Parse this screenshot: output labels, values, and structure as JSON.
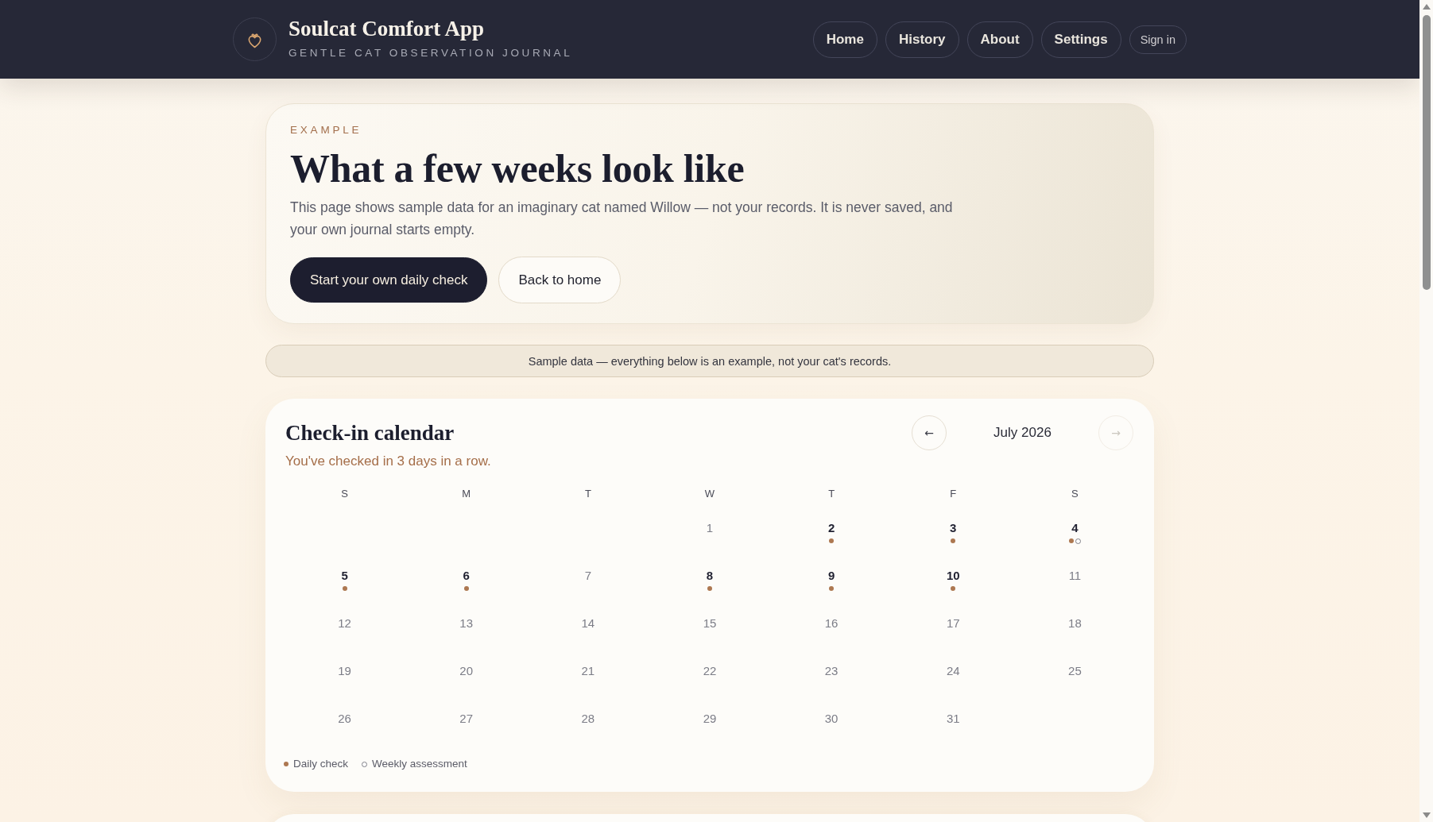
{
  "header": {
    "app_title": "Soulcat Comfort App",
    "tagline": "GENTLE CAT OBSERVATION JOURNAL",
    "nav": [
      "Home",
      "History",
      "About",
      "Settings"
    ],
    "sign_in": "Sign in"
  },
  "hero": {
    "eyebrow": "EXAMPLE",
    "title": "What a few weeks look like",
    "description": "This page shows sample data for an imaginary cat named Willow — not your records. It is never saved, and your own journal starts empty.",
    "buttons": [
      {
        "label": "Start your own daily check",
        "kind": "primary"
      },
      {
        "label": "Back to home",
        "kind": "secondary"
      }
    ]
  },
  "notice": "Sample data — everything below is an example, not your cat's records.",
  "calendar": {
    "title": "Check-in calendar",
    "streak": "You've checked in 3 days in a row.",
    "prev": {
      "label": "←",
      "disabled": false
    },
    "month": "July 2026",
    "next": {
      "label": "→",
      "disabled": true
    },
    "weekdays": [
      "S",
      "M",
      "T",
      "W",
      "T",
      "F",
      "S"
    ],
    "weeks": [
      {
        "days": [
          {
            "kind": "blank"
          },
          {
            "kind": "blank"
          },
          {
            "kind": "blank"
          },
          {
            "kind": "day",
            "date": "1",
            "daily": false,
            "weekly": false
          },
          {
            "kind": "day",
            "date": "2",
            "daily": true,
            "weekly": false
          },
          {
            "kind": "day",
            "date": "3",
            "daily": true,
            "weekly": false
          },
          {
            "kind": "day",
            "date": "4",
            "daily": true,
            "weekly": true
          }
        ]
      },
      {
        "days": [
          {
            "kind": "day",
            "date": "5",
            "daily": true,
            "weekly": false
          },
          {
            "kind": "day",
            "date": "6",
            "daily": true,
            "weekly": false
          },
          {
            "kind": "day",
            "date": "7",
            "daily": false,
            "weekly": false
          },
          {
            "kind": "day",
            "date": "8",
            "daily": true,
            "weekly": false
          },
          {
            "kind": "day",
            "date": "9",
            "daily": true,
            "weekly": false
          },
          {
            "kind": "day",
            "date": "10",
            "daily": true,
            "weekly": false
          },
          {
            "kind": "day",
            "date": "11",
            "daily": false,
            "weekly": false
          }
        ]
      },
      {
        "days": [
          {
            "kind": "day",
            "date": "12",
            "daily": false,
            "weekly": false
          },
          {
            "kind": "day",
            "date": "13",
            "daily": false,
            "weekly": false
          },
          {
            "kind": "day",
            "date": "14",
            "daily": false,
            "weekly": false
          },
          {
            "kind": "day",
            "date": "15",
            "daily": false,
            "weekly": false
          },
          {
            "kind": "day",
            "date": "16",
            "daily": false,
            "weekly": false
          },
          {
            "kind": "day",
            "date": "17",
            "daily": false,
            "weekly": false
          },
          {
            "kind": "day",
            "date": "18",
            "daily": false,
            "weekly": false
          }
        ]
      },
      {
        "days": [
          {
            "kind": "day",
            "date": "19",
            "daily": false,
            "weekly": false
          },
          {
            "kind": "day",
            "date": "20",
            "daily": false,
            "weekly": false
          },
          {
            "kind": "day",
            "date": "21",
            "daily": false,
            "weekly": false
          },
          {
            "kind": "day",
            "date": "22",
            "daily": false,
            "weekly": false
          },
          {
            "kind": "day",
            "date": "23",
            "daily": false,
            "weekly": false
          },
          {
            "kind": "day",
            "date": "24",
            "daily": false,
            "weekly": false
          },
          {
            "kind": "day",
            "date": "25",
            "daily": false,
            "weekly": false
          }
        ]
      },
      {
        "days": [
          {
            "kind": "day",
            "date": "26",
            "daily": false,
            "weekly": false
          },
          {
            "kind": "day",
            "date": "27",
            "daily": false,
            "weekly": false
          },
          {
            "kind": "day",
            "date": "28",
            "daily": false,
            "weekly": false
          },
          {
            "kind": "day",
            "date": "29",
            "daily": false,
            "weekly": false
          },
          {
            "kind": "day",
            "date": "30",
            "daily": false,
            "weekly": false
          },
          {
            "kind": "day",
            "date": "31",
            "daily": false,
            "weekly": false
          },
          {
            "kind": "blank"
          }
        ]
      }
    ],
    "legend": [
      {
        "kind": "daily",
        "label": "Daily check"
      },
      {
        "kind": "weekly",
        "label": "Weekly assessment"
      }
    ]
  }
}
